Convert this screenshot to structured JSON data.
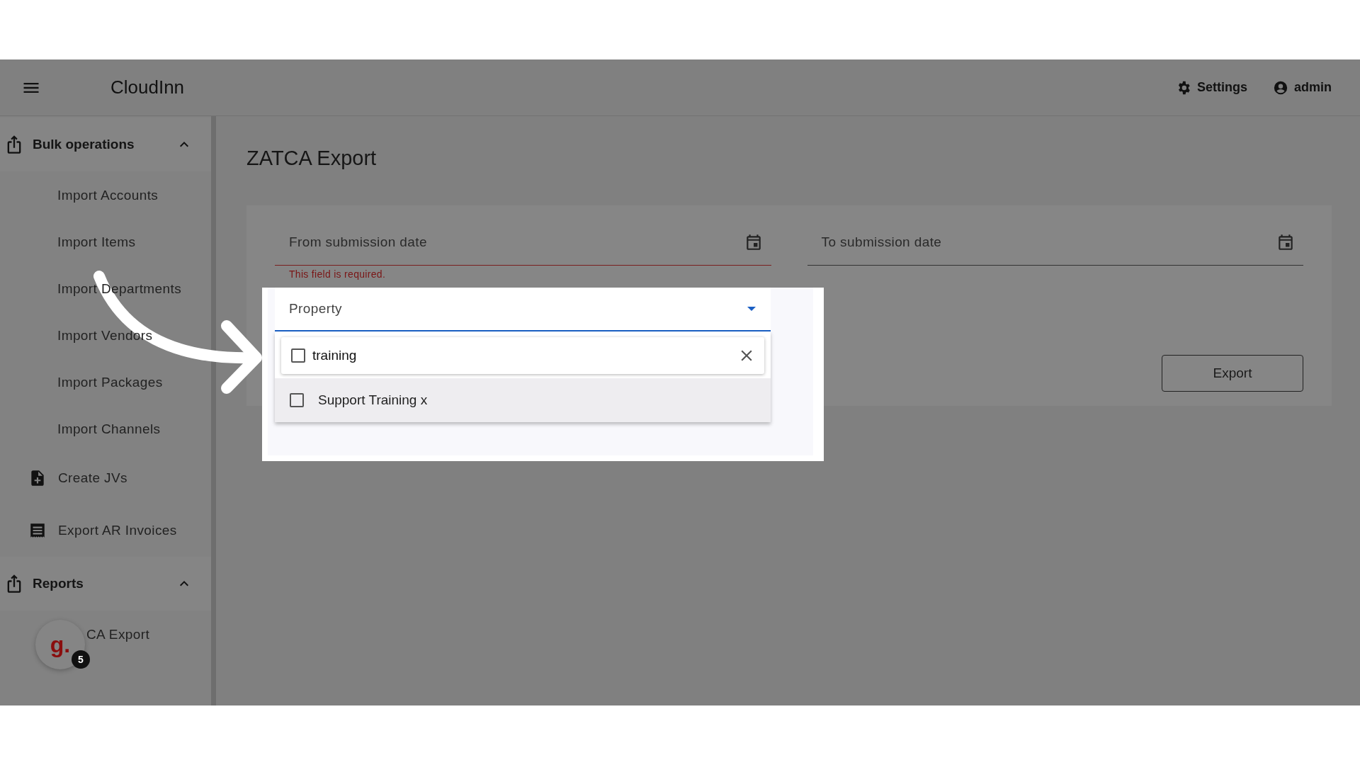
{
  "header": {
    "app_title": "CloudInn",
    "settings": "Settings",
    "user": "admin"
  },
  "sidebar": {
    "items": [
      {
        "kind": "group",
        "label": "Bulk operations",
        "expanded": true,
        "children": [
          {
            "label": "Import Accounts"
          },
          {
            "label": "Import Items"
          },
          {
            "label": "Import Departments"
          },
          {
            "label": "Import Vendors"
          },
          {
            "label": "Import Packages"
          },
          {
            "label": "Import Channels"
          }
        ]
      },
      {
        "kind": "document",
        "label": "Create JVs"
      },
      {
        "kind": "receipt",
        "label": "Export AR Invoices"
      },
      {
        "kind": "group",
        "label": "Reports",
        "expanded": true,
        "children": [
          {
            "label": "CA Export",
            "kind": "partly-covered"
          }
        ]
      }
    ]
  },
  "page": {
    "title": "ZATCA Export",
    "from_date": {
      "label": "From submission date",
      "error": "This field is required."
    },
    "to_date": {
      "label": "To submission date"
    },
    "property": {
      "label": "Property",
      "open": true,
      "search": {
        "value": "training",
        "checked": false
      },
      "options": [
        {
          "label": "Support Training x",
          "checked": false
        }
      ]
    },
    "export_button": "Export"
  },
  "chat_widget": {
    "logo": "g.",
    "badge": "5"
  }
}
